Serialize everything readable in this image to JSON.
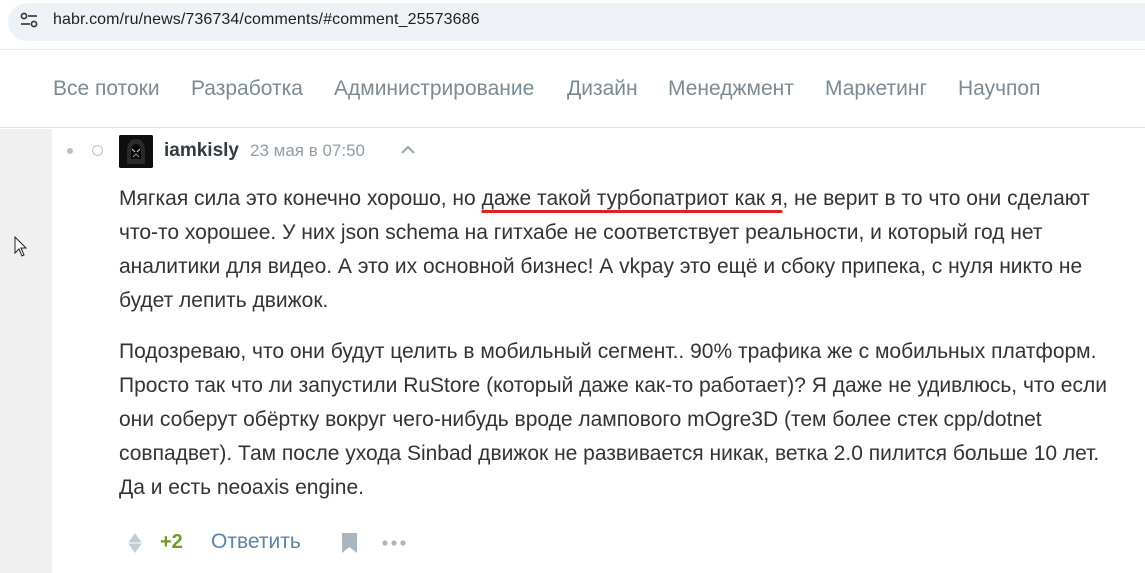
{
  "browser": {
    "url": "habr.com/ru/news/736734/comments/#comment_25573686",
    "site_settings_icon": "tune-icon"
  },
  "hubs": [
    {
      "label": "Все потоки"
    },
    {
      "label": "Разработка"
    },
    {
      "label": "Администрирование"
    },
    {
      "label": "Дизайн"
    },
    {
      "label": "Менеджмент"
    },
    {
      "label": "Маркетинг"
    },
    {
      "label": "Научпоп"
    }
  ],
  "comment": {
    "username": "iamkisly",
    "timestamp": "23 мая в 07:50",
    "paragraph1": {
      "before": "Мягкая сила это конечно хорошо, но ",
      "highlight": "даже такой турбопатриот как я",
      "after": ", не верит в то что они сделают что-то хорошее. У них json schema на гитхабе не соответствует реальности, и который год нет аналитики для видео. А это их основной бизнес! А vkpay это ещё и сбоку припека, с нуля никто не будет лепить движок."
    },
    "paragraph2": "Подозреваю, что они будут целить в мобильный сегмент.. 90% трафика же с мобильных платформ. Просто так что ли запустили RuStore (который даже как-то работает)? Я даже не удивлюсь, что если они соберут обёртку вокруг чего-нибудь вроде лампового mOgre3D (тем более стек cpp/dotnet совпадвет). Там после ухода Sinbad движок не развивается никак, ветка 2.0 пилится больше 10 лет. Да и есть neoaxis engine.",
    "score": "+2",
    "reply_label": "Ответить"
  },
  "colors": {
    "hub_text": "#7b8a95",
    "score_positive": "#6e9a2a",
    "reply_link": "#5d84a6",
    "highlight_underline": "#e02020",
    "page_background": "#f0f0f0"
  }
}
